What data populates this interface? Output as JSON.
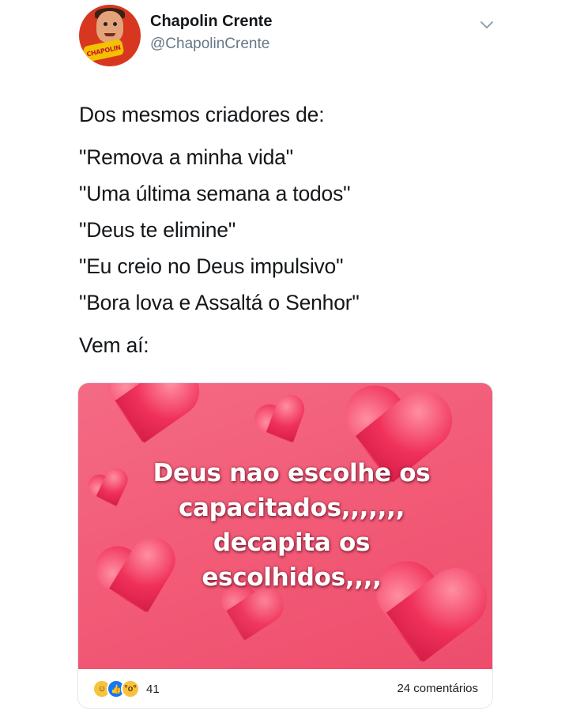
{
  "header": {
    "display_name": "Chapolin Crente",
    "handle": "@ChapolinCrente",
    "avatar_logo_text": "CHAPOLIN",
    "menu_icon": "chevron-down-icon"
  },
  "tweet": {
    "lines": [
      "Dos mesmos criadores de:",
      "\"Remova a minha vida\"",
      "\"Uma última semana a todos\"",
      "\"Deus te elimine\"",
      "\"Eu creio no Deus impulsivo\"",
      "\"Bora lova e Assaltá o Senhor\"",
      "Vem aí:"
    ]
  },
  "card": {
    "caption_lines": [
      "Deus nao escolhe os",
      "capacitados,,,,,,,",
      "decapita os",
      "escolhidos,,,,"
    ],
    "reactions": [
      "haha",
      "like",
      "wow"
    ],
    "reaction_count": "41",
    "comments": "24 comentários",
    "colors": {
      "background": "#f25b77",
      "heart": "#f0315a"
    }
  }
}
